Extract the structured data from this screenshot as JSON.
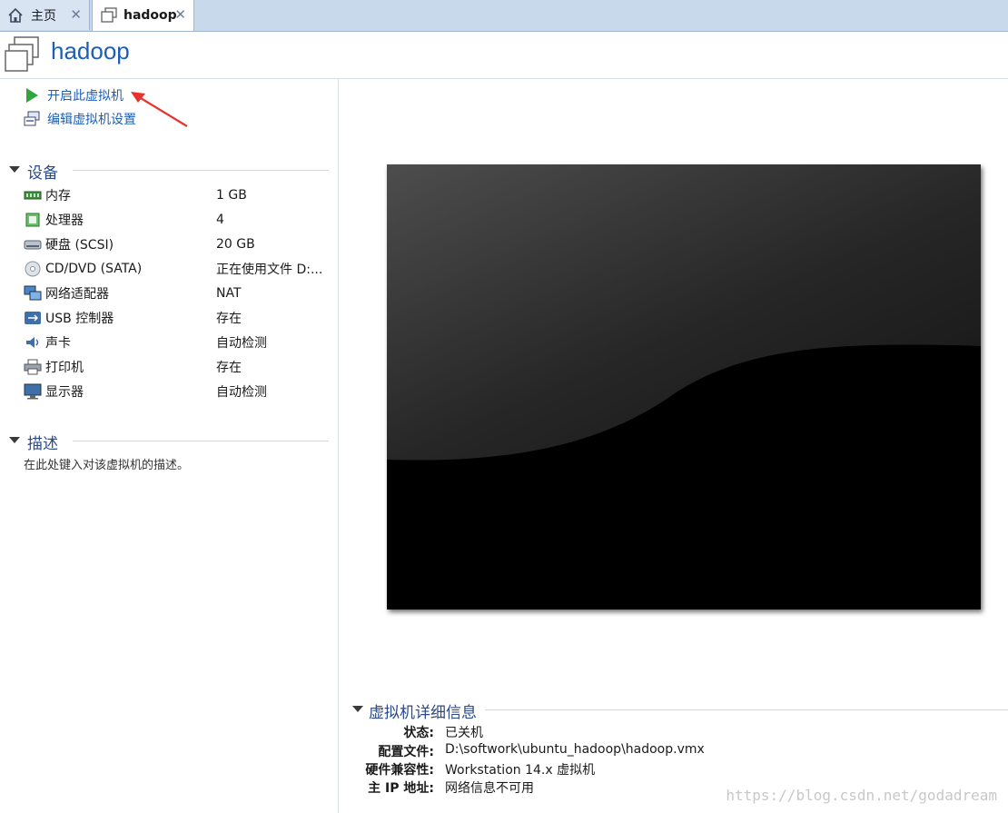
{
  "tabs": [
    {
      "label": "主页",
      "icon": "home-icon"
    },
    {
      "label": "hadoop",
      "icon": "vm-icon"
    }
  ],
  "header": {
    "title": "hadoop"
  },
  "actions": [
    {
      "label": "开启此虚拟机",
      "icon": "play-icon"
    },
    {
      "label": "编辑虚拟机设置",
      "icon": "settings-icon"
    }
  ],
  "devices": {
    "title": "设备",
    "items": [
      {
        "name": "内存",
        "value": "1 GB",
        "icon": "memory-icon"
      },
      {
        "name": "处理器",
        "value": "4",
        "icon": "processor-icon"
      },
      {
        "name": "硬盘 (SCSI)",
        "value": "20 GB",
        "icon": "disk-icon"
      },
      {
        "name": "CD/DVD (SATA)",
        "value": "正在使用文件 D:...",
        "icon": "cd-icon"
      },
      {
        "name": "网络适配器",
        "value": "NAT",
        "icon": "network-icon"
      },
      {
        "name": "USB 控制器",
        "value": "存在",
        "icon": "usb-icon"
      },
      {
        "name": "声卡",
        "value": "自动检测",
        "icon": "sound-icon"
      },
      {
        "name": "打印机",
        "value": "存在",
        "icon": "printer-icon"
      },
      {
        "name": "显示器",
        "value": "自动检测",
        "icon": "monitor-icon"
      }
    ]
  },
  "description": {
    "title": "描述",
    "placeholder": "在此处键入对该虚拟机的描述。"
  },
  "details": {
    "title": "虚拟机详细信息",
    "rows": [
      {
        "key": "状态:",
        "value": "已关机"
      },
      {
        "key": "配置文件:",
        "value": "D:\\softwork\\ubuntu_hadoop\\hadoop.vmx"
      },
      {
        "key": "硬件兼容性:",
        "value": "Workstation 14.x 虚拟机"
      },
      {
        "key": "主 IP 地址:",
        "value": "网络信息不可用"
      }
    ]
  },
  "watermark": "https://blog.csdn.net/godadream",
  "colors": {
    "link": "#1e5fb5",
    "section": "#2b4a8a",
    "tabbar": "#c9d9ec",
    "annotation_arrow": "#e8322c"
  }
}
